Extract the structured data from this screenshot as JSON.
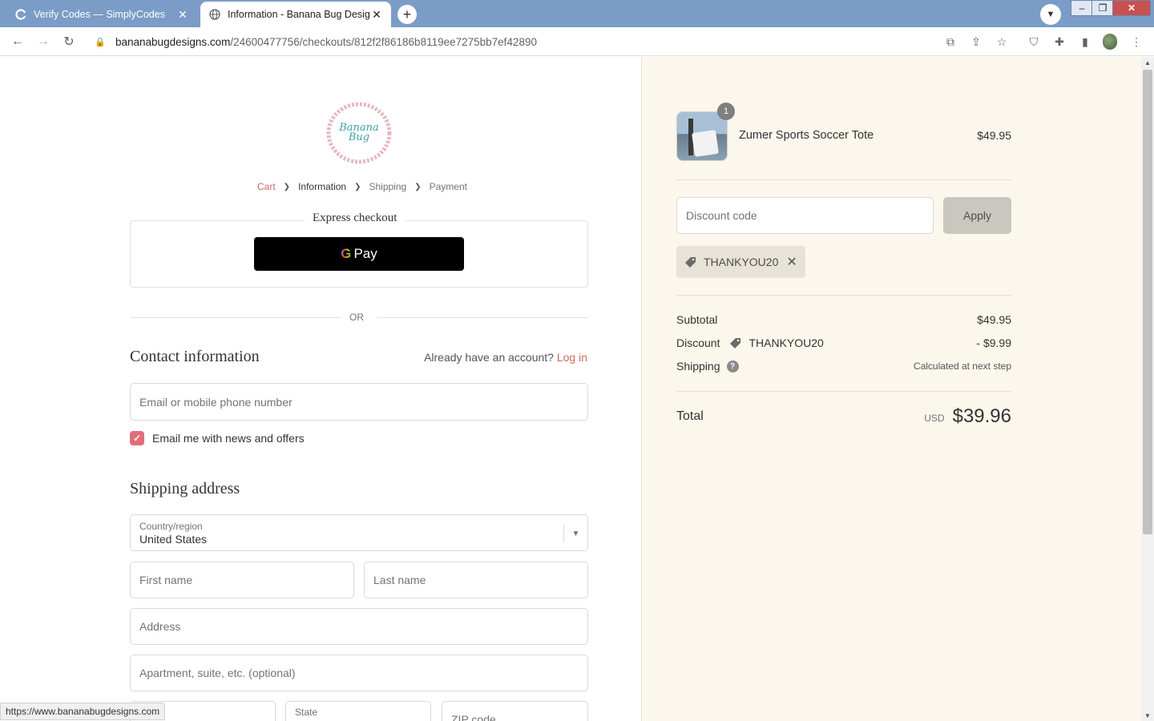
{
  "browser": {
    "tabs": [
      {
        "title": "Verify Codes — SimplyCodes"
      },
      {
        "title": "Information - Banana Bug Designs"
      }
    ],
    "url": {
      "host": "bananabugdesigns.com",
      "path": "/24600477756/checkouts/812f2f86186b8119ee7275bb7ef42890"
    },
    "status_url": "https://www.bananabugdesigns.com"
  },
  "logo": {
    "line1": "Banana",
    "line2": "Bug"
  },
  "breadcrumbs": [
    "Cart",
    "Information",
    "Shipping",
    "Payment"
  ],
  "express": {
    "title": "Express checkout",
    "gpay_g": "G",
    "gpay_label": "Pay"
  },
  "or_label": "OR",
  "contact": {
    "heading": "Contact information",
    "have_account": "Already have an account?",
    "login": "Log in",
    "email_placeholder": "Email or mobile phone number",
    "newsletter_label": "Email me with news and offers",
    "newsletter_checked": true
  },
  "shipping": {
    "heading": "Shipping address",
    "country_label": "Country/region",
    "country_value": "United States",
    "first_name": "First name",
    "last_name": "Last name",
    "address": "Address",
    "apartment": "Apartment, suite, etc. (optional)",
    "state": "State",
    "zip": "ZIP code"
  },
  "summary": {
    "product": {
      "name": "Zumer Sports Soccer Tote",
      "price": "$49.95",
      "qty": "1"
    },
    "discount_placeholder": "Discount code",
    "apply_label": "Apply",
    "applied_code": "THANKYOU20",
    "subtotal_label": "Subtotal",
    "subtotal_value": "$49.95",
    "discount_label": "Discount",
    "discount_code": "THANKYOU20",
    "discount_value": "- $9.99",
    "shipping_label": "Shipping",
    "shipping_value": "Calculated at next step",
    "total_label": "Total",
    "currency": "USD",
    "total_value": "$39.96"
  },
  "colors": {
    "accent": "#c96b5c",
    "checkbox": "#e26d7a",
    "sidebar_bg": "#fbf7ed"
  }
}
